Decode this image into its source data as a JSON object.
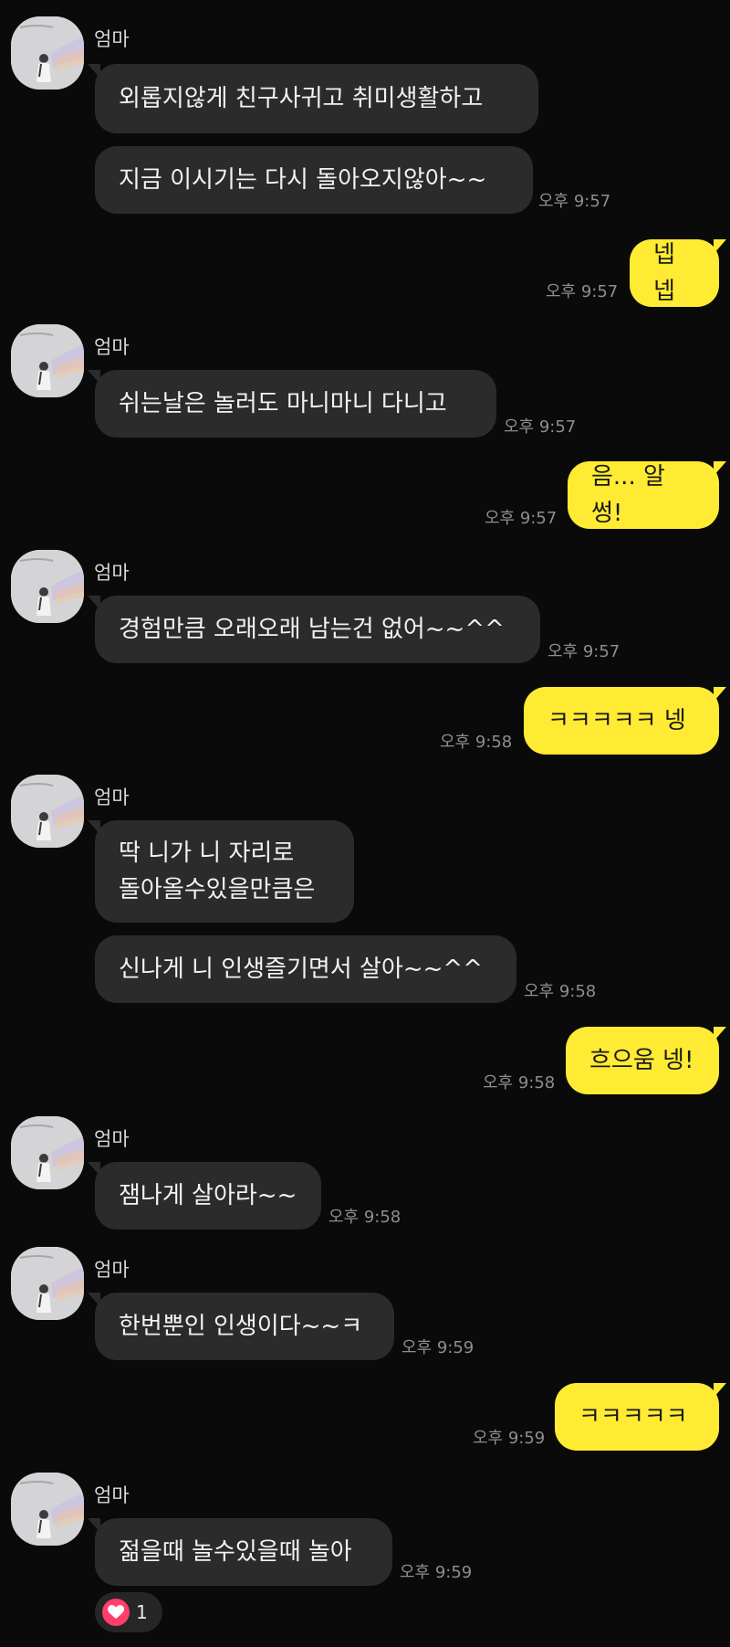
{
  "sender_name": "엄마",
  "messages": [
    {
      "id": 1,
      "dir": "in",
      "text": "외롭지않게 친구사귀고 취미생활하고",
      "time": ""
    },
    {
      "id": 2,
      "dir": "in",
      "text": "지금 이시기는 다시 돌아오지않아~~",
      "time": "오후 9:57"
    },
    {
      "id": 3,
      "dir": "out",
      "text": "넵넵",
      "time": "오후 9:57"
    },
    {
      "id": 4,
      "dir": "in",
      "text": "쉬는날은 놀러도 마니마니 다니고",
      "time": "오후 9:57"
    },
    {
      "id": 5,
      "dir": "out",
      "text": "음... 알썽!",
      "time": "오후 9:57"
    },
    {
      "id": 6,
      "dir": "in",
      "text": "경험만큼 오래오래 남는건 없어~~^^",
      "time": "오후 9:57"
    },
    {
      "id": 7,
      "dir": "out",
      "text": "ㅋㅋㅋㅋㅋ 넹",
      "time": "오후 9:58"
    },
    {
      "id": 8,
      "dir": "in",
      "text": "딱 니가 니 자리로\n돌아올수있을만큼은",
      "time": ""
    },
    {
      "id": 9,
      "dir": "in",
      "text": "신나게 니 인생즐기면서 살아~~^^",
      "time": "오후 9:58"
    },
    {
      "id": 10,
      "dir": "out",
      "text": "흐으움 넹!",
      "time": "오후 9:58"
    },
    {
      "id": 11,
      "dir": "in",
      "text": "잼나게 살아라~~",
      "time": "오후 9:58"
    },
    {
      "id": 12,
      "dir": "in",
      "text": "한번뿐인 인생이다~~ㅋ",
      "time": "오후 9:59"
    },
    {
      "id": 13,
      "dir": "out",
      "text": "ㅋㅋㅋㅋㅋ",
      "time": "오후 9:59"
    },
    {
      "id": 14,
      "dir": "in",
      "text": "젊을때 놀수있을때 놀아",
      "time": "오후 9:59"
    }
  ],
  "reaction": {
    "icon": "heart-icon",
    "count": "1",
    "color": "#ff3e6c"
  },
  "colors": {
    "background": "#0a0a0a",
    "incoming": "#2b2b2b",
    "outgoing": "#ffeb33"
  }
}
